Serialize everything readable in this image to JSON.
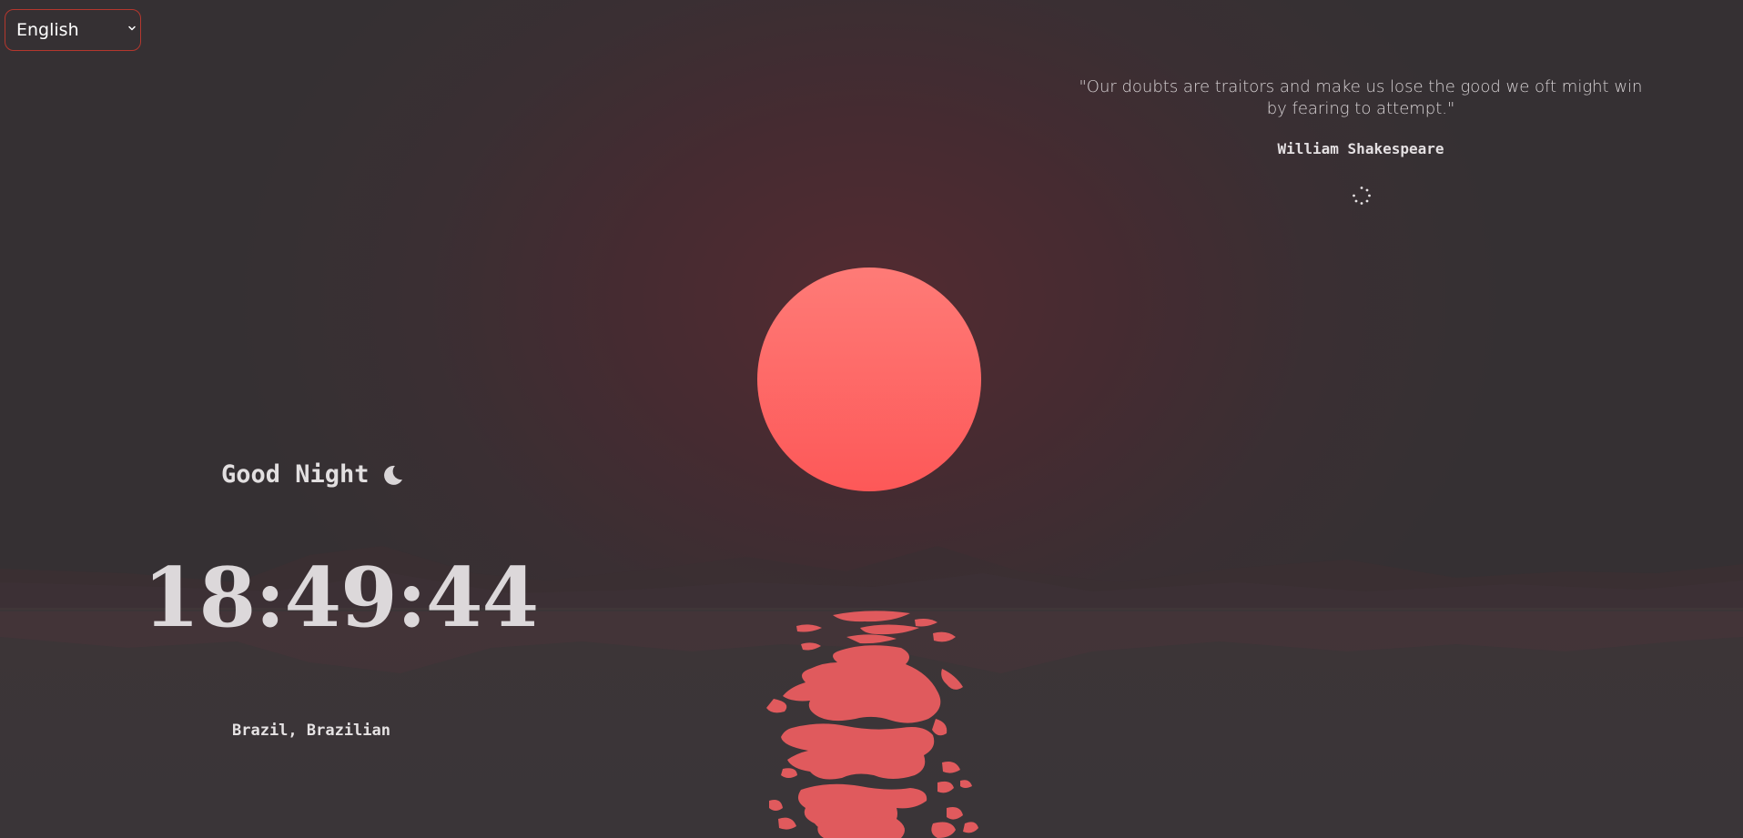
{
  "language_selector": {
    "selected": "English",
    "options": [
      "English"
    ]
  },
  "quote": {
    "text": "\"Our doubts are traitors and make us lose the good we oft might win by fearing to attempt.\"",
    "author": "William Shakespeare"
  },
  "greeting": {
    "text": "Good Night",
    "icon": "moon-icon"
  },
  "clock": {
    "time": "18:49:44"
  },
  "location": {
    "text": "Brazil, Brazilian"
  },
  "colors": {
    "background": "#353033",
    "sun_top": "#fe7b77",
    "sun_bottom": "#fd5858",
    "reflection": "#e05a5d",
    "select_border": "#b5372e"
  }
}
